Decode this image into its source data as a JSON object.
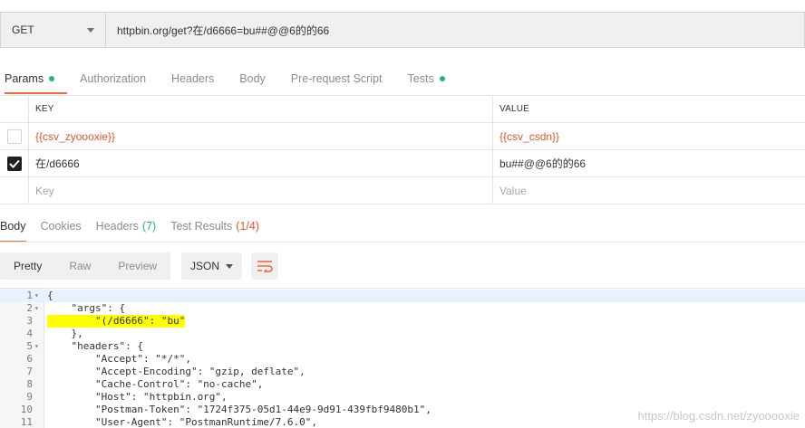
{
  "request": {
    "method": "GET",
    "url": "httpbin.org/get?在/d6666=bu##@@6的的66"
  },
  "request_tabs": [
    {
      "label": "Params",
      "dot": true
    },
    {
      "label": "Authorization",
      "dot": false
    },
    {
      "label": "Headers",
      "dot": false
    },
    {
      "label": "Body",
      "dot": false
    },
    {
      "label": "Pre-request Script",
      "dot": false
    },
    {
      "label": "Tests",
      "dot": true
    }
  ],
  "params": {
    "header_key": "KEY",
    "header_value": "VALUE",
    "rows": [
      {
        "checked": false,
        "key": "{{csv_zyoooxie}}",
        "value": "{{csv_csdn}}"
      },
      {
        "checked": true,
        "key": "在/d6666",
        "value": "bu##@@6的的66"
      }
    ],
    "placeholder_key": "Key",
    "placeholder_value": "Value"
  },
  "response_tabs": [
    {
      "label": "Body",
      "count": ""
    },
    {
      "label": "Cookies",
      "count": ""
    },
    {
      "label": "Headers",
      "count": "(7)"
    },
    {
      "label": "Test Results",
      "count": "(1/4)"
    }
  ],
  "view_modes": [
    "Pretty",
    "Raw",
    "Preview"
  ],
  "format": "JSON",
  "code_lines": [
    {
      "n": "1",
      "fold": "▾",
      "text": "{"
    },
    {
      "n": "2",
      "fold": "▾",
      "text": "    \"args\": {"
    },
    {
      "n": "3",
      "fold": "",
      "text": "        \"(/d6666\": \"bu\""
    },
    {
      "n": "4",
      "fold": "",
      "text": "    },"
    },
    {
      "n": "5",
      "fold": "▾",
      "text": "    \"headers\": {"
    },
    {
      "n": "6",
      "fold": "",
      "text": "        \"Accept\": \"*/*\","
    },
    {
      "n": "7",
      "fold": "",
      "text": "        \"Accept-Encoding\": \"gzip, deflate\","
    },
    {
      "n": "8",
      "fold": "",
      "text": "        \"Cache-Control\": \"no-cache\","
    },
    {
      "n": "9",
      "fold": "",
      "text": "        \"Host\": \"httpbin.org\","
    },
    {
      "n": "10",
      "fold": "",
      "text": "        \"Postman-Token\": \"1724f375-05d1-44e9-9d91-439fbf9480b1\","
    },
    {
      "n": "11",
      "fold": "",
      "text": "        \"User-Agent\": \"PostmanRuntime/7.6.0\","
    }
  ],
  "watermark": "https://blog.csdn.net/zyooooxie",
  "colors": {
    "accent": "#f26b3a",
    "green": "#26b47f",
    "highlight": "#ffff00"
  }
}
